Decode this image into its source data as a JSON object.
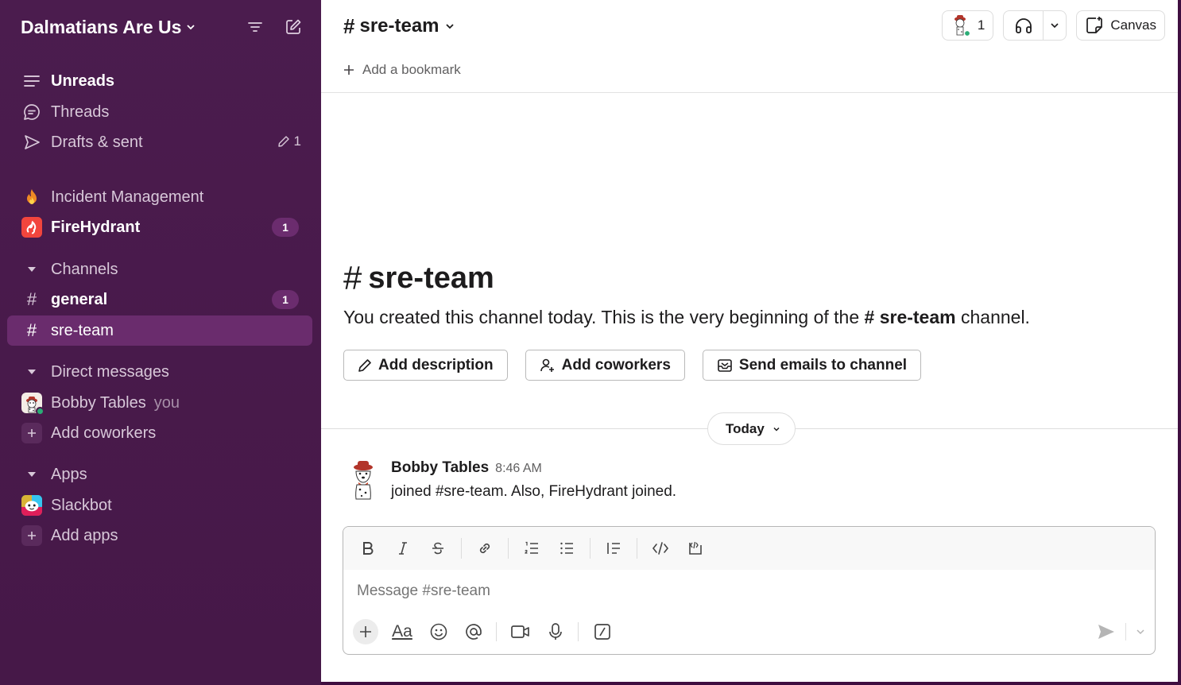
{
  "workspace": {
    "name": "Dalmatians Are Us"
  },
  "sidebar": {
    "nav": [
      {
        "label": "Unreads",
        "icon": "unreads-icon"
      },
      {
        "label": "Threads",
        "icon": "threads-icon"
      },
      {
        "label": "Drafts & sent",
        "icon": "send-icon",
        "count": "1"
      }
    ],
    "apps_top": [
      {
        "label": "Incident Management",
        "icon": "fire-icon"
      },
      {
        "label": "FireHydrant",
        "icon": "firehydrant-logo",
        "badge": "1"
      }
    ],
    "channels_header": "Channels",
    "channels": [
      {
        "label": "general",
        "badge": "1"
      },
      {
        "label": "sre-team"
      }
    ],
    "dm_header": "Direct messages",
    "dms": [
      {
        "label": "Bobby Tables",
        "suffix": "you"
      },
      {
        "label": "Add coworkers"
      }
    ],
    "apps_header": "Apps",
    "apps": [
      {
        "label": "Slackbot"
      },
      {
        "label": "Add apps"
      }
    ]
  },
  "channel": {
    "name": "sre-team",
    "member_count": "1",
    "canvas_label": "Canvas",
    "bookmark_label": "Add a bookmark",
    "intro_text_before": "You created this channel today. This is the very beginning of the",
    "intro_text_after": "channel.",
    "buttons": {
      "add_description": "Add description",
      "add_coworkers": "Add coworkers",
      "send_emails": "Send emails to channel"
    },
    "day_label": "Today"
  },
  "message": {
    "author": "Bobby Tables",
    "time": "8:46 AM",
    "text": "joined #sre-team. Also, FireHydrant joined."
  },
  "composer": {
    "placeholder": "Message #sre-team",
    "format_label": "Aa"
  },
  "colors": {
    "sidebar_bg": "#4a1a4c",
    "active_row": "#6a2c6d",
    "presence": "#2bac76"
  }
}
